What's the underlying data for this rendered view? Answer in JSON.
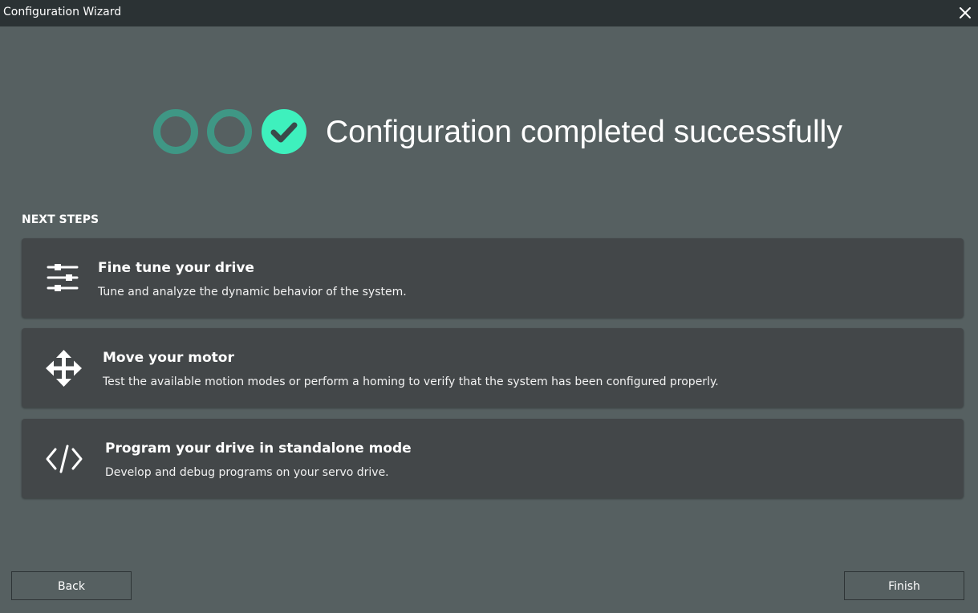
{
  "window": {
    "title": "Configuration Wizard",
    "close_icon": "close-icon"
  },
  "status": {
    "headline": "Configuration completed successfully",
    "steps": [
      {
        "state": "complete",
        "icon": "ring-icon"
      },
      {
        "state": "complete",
        "icon": "ring-icon"
      },
      {
        "state": "current-complete",
        "icon": "check-circle-icon"
      }
    ]
  },
  "next_steps": {
    "label": "NEXT STEPS",
    "items": [
      {
        "title": "Fine tune your drive",
        "description": "Tune and analyze the dynamic behavior of the system.",
        "icon": "sliders-icon"
      },
      {
        "title": "Move your motor",
        "description": "Test the available motion modes or perform a homing to verify that the system has been configured properly.",
        "icon": "move-arrows-icon"
      },
      {
        "title": "Program your drive in standalone mode",
        "description": "Develop and debug programs on your servo drive.",
        "icon": "code-icon"
      }
    ]
  },
  "footer": {
    "back_label": "Back",
    "finish_label": "Finish"
  },
  "colors": {
    "background": "#566061",
    "titlebar": "#2b3234",
    "card": "#434749",
    "ring": "#3f9785",
    "accent": "#3ef0bd"
  }
}
